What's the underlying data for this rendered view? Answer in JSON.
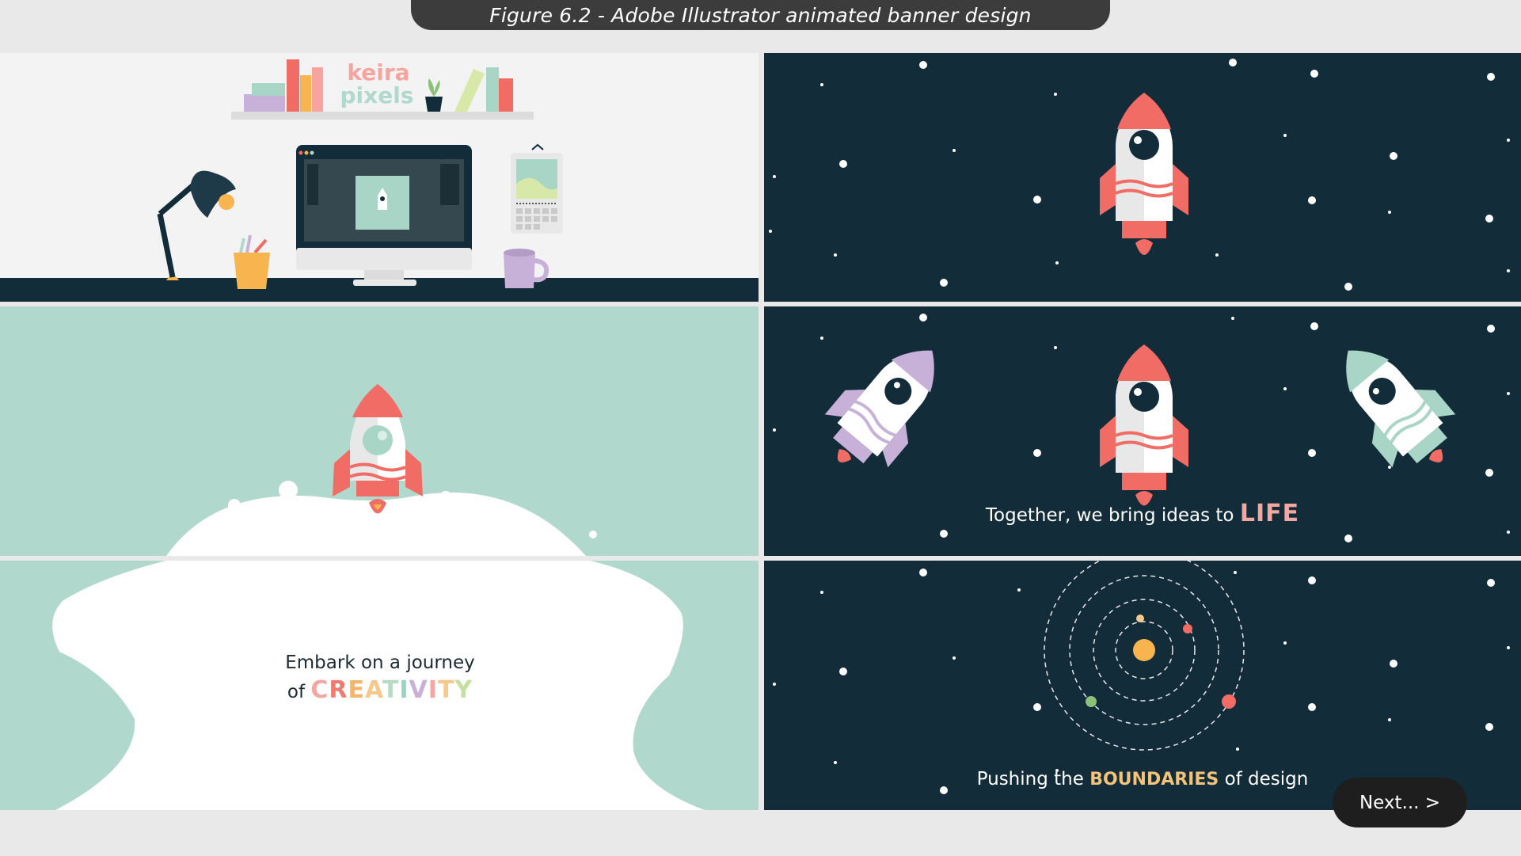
{
  "caption": "Figure 6.2 - Adobe Illustrator animated banner design",
  "office": {
    "logo_line1": "keira",
    "logo_line2": "pixels"
  },
  "creativity": {
    "line1": "Embark on a journey",
    "line2_prefix": "of",
    "letters": [
      "C",
      "R",
      "E",
      "A",
      "T",
      "I",
      "V",
      "I",
      "T",
      "Y"
    ],
    "letter_colors": [
      "#f4a6a0",
      "#f07a6f",
      "#f4b56a",
      "#f7c88b",
      "#b5dcc2",
      "#9ad2c2",
      "#c7b1d8",
      "#f4a6a0",
      "#f7c88b",
      "#c4e0a0"
    ]
  },
  "together": {
    "prefix": "Together, we bring ideas to",
    "highlight": "LIFE"
  },
  "boundaries": {
    "prefix": "Pushing the",
    "highlight": "BOUNDARIES",
    "suffix": "of design",
    "highlight_color": "#f4c37a"
  },
  "next_button": {
    "label": "Next... >"
  },
  "colors": {
    "navy": "#122c3a",
    "mint": "#b0d8cc",
    "coral": "#f06c64",
    "lavender": "#c7b1d8",
    "orange": "#f7b44f"
  }
}
